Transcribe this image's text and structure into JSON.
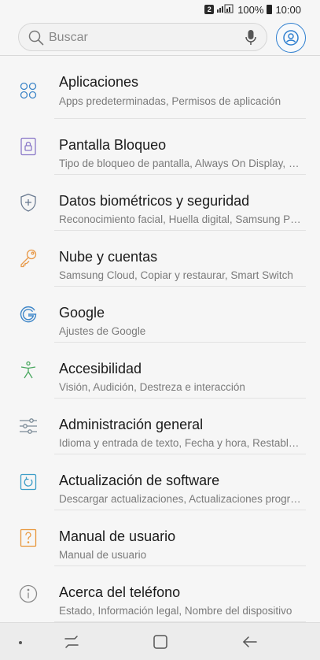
{
  "status_bar": {
    "sim_slot": "2",
    "battery": "100%",
    "time": "10:00"
  },
  "search": {
    "placeholder": "Buscar"
  },
  "settings": [
    {
      "title": "Aplicaciones",
      "subtitle": "Apps predeterminadas, Permisos de aplicación",
      "icon": "apps-icon",
      "color": "#3e86c8"
    },
    {
      "title": "Pantalla Bloqueo",
      "subtitle": "Tipo de bloqueo de pantalla, Always On Display, Estilo",
      "icon": "lock-screen-icon",
      "color": "#8a78c8"
    },
    {
      "title": "Datos biométricos y seguridad",
      "subtitle": "Reconocimiento facial, Huella digital, Samsung Pass",
      "icon": "shield-icon",
      "color": "#6a7a90"
    },
    {
      "title": "Nube y cuentas",
      "subtitle": "Samsung Cloud, Copiar y restaurar, Smart Switch",
      "icon": "key-icon",
      "color": "#e89a4a"
    },
    {
      "title": "Google",
      "subtitle": "Ajustes de Google",
      "icon": "google-icon",
      "color": "#3e86c8"
    },
    {
      "title": "Accesibilidad",
      "subtitle": "Visión, Audición, Destreza e interacción",
      "icon": "accessibility-icon",
      "color": "#4aa860"
    },
    {
      "title": "Administración general",
      "subtitle": "Idioma y entrada de texto, Fecha y hora, Restablecer",
      "icon": "sliders-icon",
      "color": "#7a8a96"
    },
    {
      "title": "Actualización de software",
      "subtitle": "Descargar actualizaciones, Actualizaciones programadas",
      "icon": "software-update-icon",
      "color": "#3e9ec8"
    },
    {
      "title": "Manual de usuario",
      "subtitle": "Manual de usuario",
      "icon": "user-manual-icon",
      "color": "#e8963a"
    },
    {
      "title": "Acerca del teléfono",
      "subtitle": "Estado, Información legal, Nombre del dispositivo",
      "icon": "info-icon",
      "color": "#8a8a8a"
    }
  ],
  "navigation": {
    "buttons": [
      "recent-apps-icon",
      "home-icon",
      "back-icon"
    ]
  }
}
